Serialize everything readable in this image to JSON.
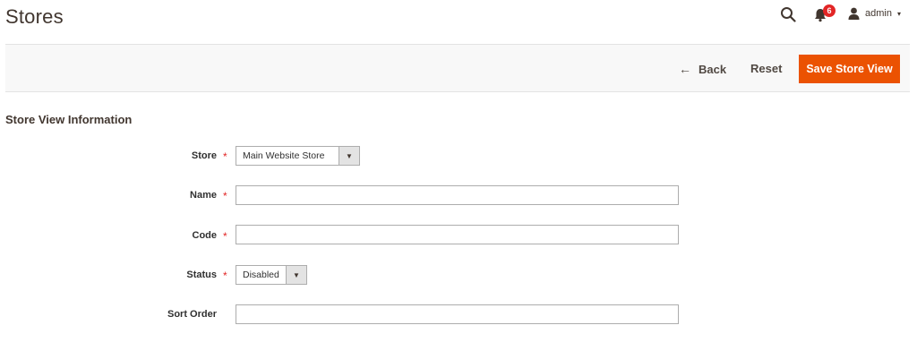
{
  "page": {
    "title": "Stores"
  },
  "header": {
    "search_icon": "search-icon",
    "notification_icon": "bell-icon",
    "notification_count": "6",
    "user_icon": "user-icon",
    "user_name": "admin",
    "user_caret": "▾"
  },
  "actions": {
    "back_label": "Back",
    "back_icon": "←",
    "reset_label": "Reset",
    "save_label": "Save Store View",
    "accent_color": "#eb5202"
  },
  "form": {
    "section_title": "Store View Information",
    "required_mark": "*",
    "store": {
      "label": "Store",
      "value": "Main Website Store"
    },
    "name": {
      "label": "Name",
      "value": ""
    },
    "code": {
      "label": "Code",
      "value": ""
    },
    "status": {
      "label": "Status",
      "value": "Disabled"
    },
    "sort_order": {
      "label": "Sort Order",
      "value": ""
    },
    "dropdown_arrow": "▼"
  }
}
